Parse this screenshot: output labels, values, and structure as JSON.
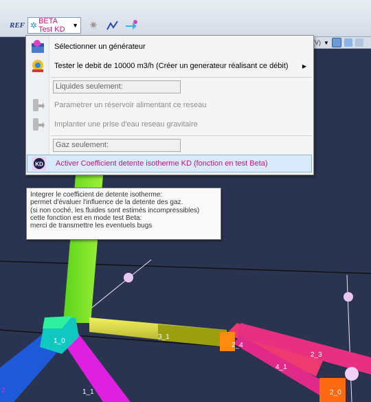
{
  "toolbar": {
    "ref_label": "REF",
    "beta_button_label": "BETA Test KD"
  },
  "menu": {
    "items": [
      {
        "label": "Sélectionner un générateur",
        "icon": "generator-star-icon",
        "enabled": true
      },
      {
        "label": "Tester le debit de 10000 m3/h (Créer un generateur réalisant ce débit)",
        "icon": "test-flow-icon",
        "enabled": true,
        "submenu": true
      },
      {
        "section": "Liquides seulement:"
      },
      {
        "label": "Parametrer un réservoir alimentant ce reseau",
        "icon": "reservoir-icon",
        "enabled": false
      },
      {
        "label": "Implanter une prise d'eau reseau gravitaire",
        "icon": "water-intake-icon",
        "enabled": false
      },
      {
        "section": "Gaz seulement:"
      },
      {
        "label": "Activer Coefficient detente isotherme KD (fonction en test Beta)",
        "icon": "kd-icon",
        "icon_text": "KD",
        "enabled": true,
        "highlighted": true
      }
    ]
  },
  "tooltip": {
    "lines": [
      "Integrer le coefficient de detente isotherme:",
      "permet d'évaluer l'influence de la detente des gaz.",
      "(si non coché, les fluides sont estimés incompressibles)",
      "cette fonction est en mode test Beta:",
      "merci de transmettre les eventuels bugs"
    ]
  },
  "viewport": {
    "node_labels": [
      "1_0",
      "3_1",
      "2_4",
      "2_3",
      "4_1",
      "1_1",
      "2_0",
      "2"
    ]
  },
  "colors": {
    "viewport_bg": "#2b3550",
    "highlight": "#c0157a",
    "menu_highlight_bg": "#d8eafc"
  }
}
